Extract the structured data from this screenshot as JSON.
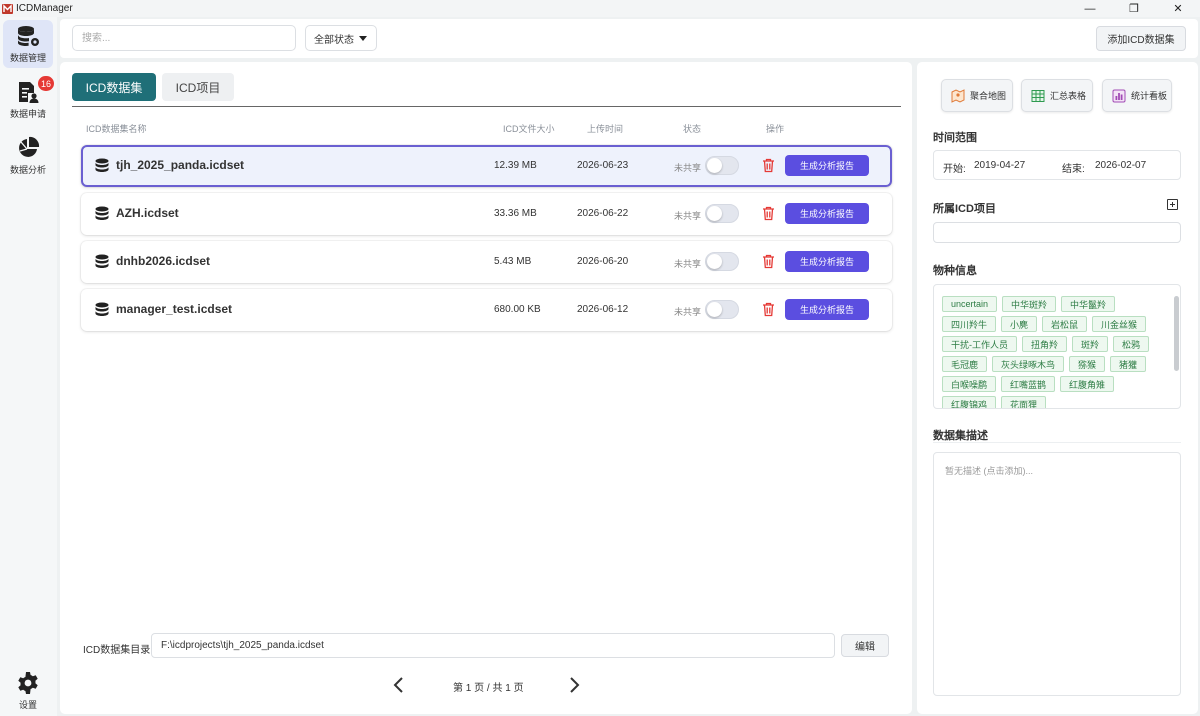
{
  "app": {
    "title": "ICDManager"
  },
  "window_controls": {
    "minimize": "—",
    "maximize": "❐",
    "close": "✕"
  },
  "nav": {
    "items": [
      {
        "label": "数据管理",
        "icon": "database-gear-icon",
        "active": true
      },
      {
        "label": "数据申请",
        "icon": "request-person-icon",
        "badge": "16"
      },
      {
        "label": "数据分析",
        "icon": "pie-chart-icon"
      }
    ],
    "settings_label": "设置"
  },
  "toolbar": {
    "search_placeholder": "搜索...",
    "status_filter": "全部状态",
    "add_button": "添加ICD数据集"
  },
  "main": {
    "tabs": [
      "ICD数据集",
      "ICD项目"
    ],
    "columns": {
      "name": "ICD数据集名称",
      "size": "ICD文件大小",
      "date": "上传时间",
      "status": "状态",
      "actions": "操作"
    },
    "rows": [
      {
        "name": "tjh_2025_panda.icdset",
        "size": "12.39 MB",
        "date": "2026-06-23",
        "share": "未共享",
        "action": "生成分析报告",
        "selected": true
      },
      {
        "name": "AZH.icdset",
        "size": "33.36 MB",
        "date": "2026-06-22",
        "share": "未共享",
        "action": "生成分析报告"
      },
      {
        "name": "dnhb2026.icdset",
        "size": "5.43 MB",
        "date": "2026-06-20",
        "share": "未共享",
        "action": "生成分析报告"
      },
      {
        "name": "manager_test.icdset",
        "size": "680.00 KB",
        "date": "2026-06-12",
        "share": "未共享",
        "action": "生成分析报告"
      }
    ],
    "directory_label": "ICD数据集目录",
    "directory_value": "F:\\icdprojects\\tjh_2025_panda.icdset",
    "edit_button": "编辑",
    "pagination": "第 1 页 / 共 1 页"
  },
  "right": {
    "buttons": [
      "聚合地图",
      "汇总表格",
      "统计看板"
    ],
    "time_title": "时间范围",
    "start_label": "开始:",
    "start_value": "2019-04-27",
    "end_label": "结束:",
    "end_value": "2026-02-07",
    "project_title": "所属ICD项目",
    "species_title": "物种信息",
    "species": [
      "uncertain",
      "中华斑羚",
      "中华鬣羚",
      "四川羚牛",
      "小麂",
      "岩松鼠",
      "川金丝猴",
      "干扰-工作人员",
      "扭角羚",
      "斑羚",
      "松鸦",
      "毛冠鹿",
      "灰头绿啄木鸟",
      "猕猴",
      "猪獾",
      "白喉噪鹛",
      "红嘴蓝鹊",
      "红腹角雉",
      "红腹锦鸡",
      "花面狸"
    ],
    "desc_title": "数据集描述",
    "desc_placeholder": "暂无描述 (点击添加)..."
  },
  "colors": {
    "accent": "#1f6f78",
    "button": "#5b4ee0",
    "selected_border": "#6a5fd1",
    "badge": "#e53935",
    "chip_text": "#2e7d45"
  }
}
